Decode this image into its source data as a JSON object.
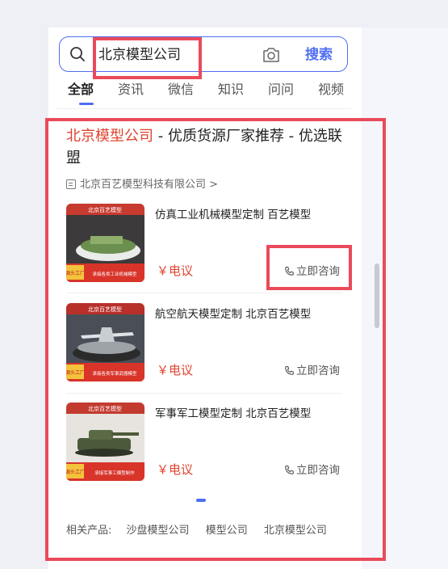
{
  "search": {
    "query": "北京模型公司",
    "button_label": "搜索"
  },
  "tabs": [
    {
      "label": "全部",
      "active": true
    },
    {
      "label": "资讯",
      "active": false
    },
    {
      "label": "微信",
      "active": false
    },
    {
      "label": "知识",
      "active": false
    },
    {
      "label": "问问",
      "active": false
    },
    {
      "label": "视频",
      "active": false
    }
  ],
  "result": {
    "title_highlight": "北京模型公司",
    "title_rest": " - 优质货源厂家推荐 - 优选联盟",
    "company": "北京百艺模型科技有限公司",
    "company_chevron": ">",
    "products": [
      {
        "name": "仿真工业机械模型定制 百艺模型",
        "price": "￥电议",
        "consult": "立即咨询",
        "thumb_header": "北京百艺模型",
        "thumb_badge": "源头工厂",
        "thumb_footer": "承接各类工业机械模型"
      },
      {
        "name": "航空航天模型定制 北京百艺模型",
        "price": "￥电议",
        "consult": "立即咨询",
        "thumb_header": "北京百艺模型",
        "thumb_badge": "源头工厂",
        "thumb_footer": "承接各类军事武器模型"
      },
      {
        "name": "军事军工模型定制 北京百艺模型",
        "price": "￥电议",
        "consult": "立即咨询",
        "thumb_header": "北京百艺模型",
        "thumb_badge": "源头工厂",
        "thumb_footer": "承接军事工模型制作"
      }
    ],
    "related_label": "相关产品:",
    "related_links": [
      "沙盘模型公司",
      "模型公司",
      "北京模型公司"
    ]
  },
  "colors": {
    "accent": "#4e6ef2",
    "highlight": "#e0432f",
    "annotation": "#ea4a5a"
  }
}
